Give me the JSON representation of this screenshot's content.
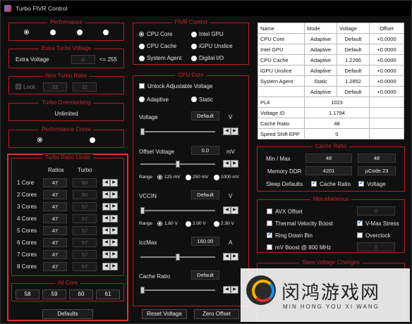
{
  "window": {
    "title": "Turbo FIVR Control"
  },
  "performance": {
    "title": "Performance",
    "radio_count": 4
  },
  "extra_turbo": {
    "title": "Extra Turbo Voltage",
    "label": "Extra Voltage",
    "value": "0",
    "hint": "<= 255"
  },
  "non_turbo": {
    "title": "Non Turbo Ratio",
    "lock_label": "Lock",
    "value1": "22",
    "value2": "22"
  },
  "turbo_oc": {
    "title": "Turbo Overclocking",
    "value": "Unlimited"
  },
  "perf_cores": {
    "title": "Performance Cores"
  },
  "turbo_limits": {
    "title": "Turbo Ratio Limits",
    "col_ratios": "Ratios",
    "col_turbo": "Turbo",
    "rows": [
      {
        "label": "1 Core",
        "ratio": "47",
        "turbo": "60"
      },
      {
        "label": "2 Cores",
        "ratio": "47",
        "turbo": "60"
      },
      {
        "label": "3 Cores",
        "ratio": "47",
        "turbo": "57"
      },
      {
        "label": "4 Cores",
        "ratio": "47",
        "turbo": "57"
      },
      {
        "label": "5 Cores",
        "ratio": "47",
        "turbo": "57"
      },
      {
        "label": "6 Cores",
        "ratio": "47",
        "turbo": "57"
      },
      {
        "label": "7 Cores",
        "ratio": "47",
        "turbo": "57"
      },
      {
        "label": "8 Cores",
        "ratio": "47",
        "turbo": "57"
      }
    ]
  },
  "all_core": {
    "title": "All Core",
    "values": [
      "58",
      "59",
      "60",
      "61"
    ]
  },
  "defaults_button": "Defaults",
  "fivr_control": {
    "title": "FIVR Control",
    "options": [
      "CPU Core",
      "Intel GPU",
      "CPU Cache",
      "iGPU Unslice",
      "System Agent",
      "Digital I/O"
    ]
  },
  "cpu_core": {
    "title": "CPU Core",
    "unlock_label": "Unlock Adjustable Voltage",
    "adaptive_label": "Adaptive",
    "static_label": "Static",
    "voltage_label": "Voltage",
    "voltage_value": "Default",
    "voltage_unit": "V",
    "voltage_level": 0,
    "offset_label": "Offset Voltage",
    "offset_value": "0.0",
    "offset_unit": "mV",
    "offset_level": 0.5,
    "range_label": "Range",
    "offset_ranges": [
      "125 mV",
      "250 mV",
      "1000 mV"
    ],
    "vccin_label": "VCCIN",
    "vccin_value": "Default",
    "vccin_unit": "V",
    "vccin_level": 0,
    "vccin_ranges": [
      "1.80 V",
      "2.00 V",
      "2.30 V"
    ],
    "iccmax_label": "IccMax",
    "iccmax_value": "160.00",
    "iccmax_unit": "A",
    "iccmax_level": 0.5,
    "cache_ratio_label": "Cache Ratio",
    "cache_ratio_value": "Default",
    "cache_ratio_level": 0
  },
  "reset_voltage_button": "Reset Voltage",
  "zero_offset_button": "Zero Offset",
  "status_table": {
    "headers": [
      "Name",
      "Mode",
      "Voltage",
      "Offset"
    ],
    "rows": [
      [
        "CPU Core",
        "Adaptive",
        "Default",
        "+0.0000"
      ],
      [
        "Intel GPU",
        "Adaptive",
        "Default",
        "+0.0000"
      ],
      [
        "CPU Cache",
        "Adaptive",
        "1.2266",
        "+0.0000"
      ],
      [
        "iGPU Unslice",
        "Adaptive",
        "Default",
        "+0.0000"
      ],
      [
        "System Agent",
        "Static",
        "1.2852",
        "+0.0000"
      ],
      [
        "",
        "Adaptive",
        "Default",
        "+0.0000"
      ]
    ],
    "info": [
      [
        "PL4",
        "1023"
      ],
      [
        "Voltage ID",
        "1.1794"
      ],
      [
        "Cache Ratio",
        "48"
      ],
      [
        "Speed Shift EPP",
        "0"
      ]
    ]
  },
  "cache_ratio": {
    "title": "Cache Ratio",
    "minmax_label": "Min / Max",
    "min": "48",
    "max": "48",
    "memory_label": "Memory DDR",
    "memory_value": "4201",
    "ucode": "µCode  23",
    "sleep_label": "Sleep Defaults",
    "cache_ratio_cb": "Cache Ratio",
    "voltage_cb": "Voltage"
  },
  "misc": {
    "title": "Miscellaneous",
    "avx_label": "AVX Offset",
    "avx_value": "0",
    "tvb_label": "Thermal Velocity Boost",
    "vmax_label": "V-Max Stress",
    "ring_label": "Ring Down Bin",
    "overclock_label": "Overclock",
    "mvboost_label": "mV Boost @ 800 MHz",
    "mvboost_value": "0"
  },
  "save_voltage": {
    "title": "Save Voltage Changes"
  },
  "watermark": {
    "cn": "闵鸿游戏网",
    "en": "MIN HONG YOU XI WANG"
  }
}
